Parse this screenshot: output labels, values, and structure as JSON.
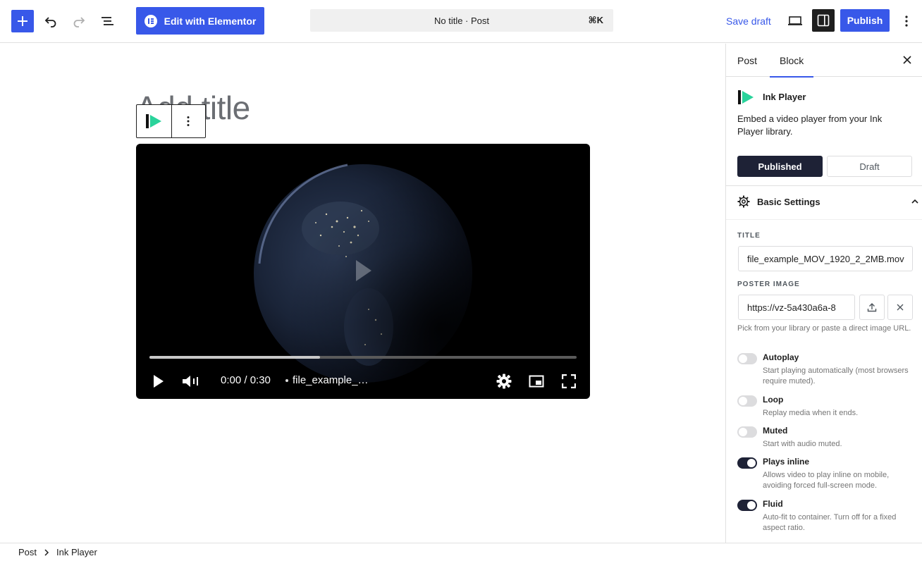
{
  "toolbar": {
    "elementor_label": "Edit with Elementor",
    "doc_title": "No title · Post",
    "shortcut": "⌘K",
    "save_draft": "Save draft",
    "publish": "Publish"
  },
  "editor": {
    "title_placeholder": "Add title"
  },
  "player": {
    "time": "0:00 / 0:30",
    "title": "file_example_…",
    "progress_buffered": 0.4
  },
  "sidebar": {
    "tabs": {
      "post": "Post",
      "block": "Block"
    },
    "block_name": "Ink Player",
    "block_desc": "Embed a video player from your Ink Player library.",
    "status": {
      "published": "Published",
      "draft": "Draft"
    },
    "panel_title": "Basic Settings",
    "fields": {
      "title_label": "TITLE",
      "title_value": "file_example_MOV_1920_2_2MB.mov",
      "poster_label": "POSTER IMAGE",
      "poster_value": "https://vz-5a430a6a-8",
      "poster_help": "Pick from your library or paste a direct image URL."
    },
    "toggles": [
      {
        "label": "Autoplay",
        "help": "Start playing automatically (most browsers require muted).",
        "on": false
      },
      {
        "label": "Loop",
        "help": "Replay media when it ends.",
        "on": false
      },
      {
        "label": "Muted",
        "help": "Start with audio muted.",
        "on": false
      },
      {
        "label": "Plays inline",
        "help": "Allows video to play inline on mobile, avoiding forced full-screen mode.",
        "on": true
      },
      {
        "label": "Fluid",
        "help": "Auto-fit to container. Turn off for a fixed aspect ratio.",
        "on": true
      }
    ]
  },
  "breadcrumb": {
    "root": "Post",
    "current": "Ink Player"
  },
  "colors": {
    "accent": "#3858e9",
    "dark": "#1e2236",
    "ink_green": "#2ad39b"
  }
}
